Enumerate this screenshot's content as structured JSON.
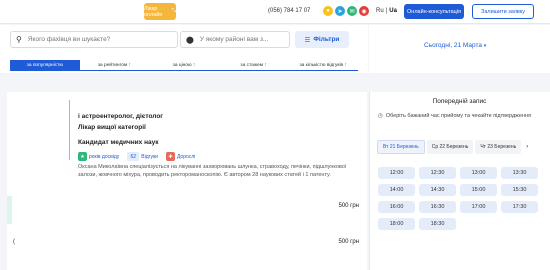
{
  "header": {
    "doctor_online_label": "Лікар онлайн",
    "phone": "(056) 784 17 07",
    "lang_ru": "Ru",
    "lang_ua": "Ua",
    "consult_button": "Онлайн-консультація",
    "request_button": "Залишити заявку"
  },
  "search": {
    "spec_placeholder": "Якого фахівця ви шукаєте?",
    "district_placeholder": "У якому районі вам з...",
    "filters_button": "Фільтри"
  },
  "sort_tabs": [
    {
      "label": "за популярністю",
      "active": true
    },
    {
      "label": "за рейтингом ↑",
      "active": false
    },
    {
      "label": "за ціною ↑",
      "active": false
    },
    {
      "label": "за стажем ↑",
      "active": false
    },
    {
      "label": "за кількістю відгуків ↑",
      "active": false
    }
  ],
  "date_select": "Сьогодні, 21 Марта",
  "doctor": {
    "title": "і астроентеролог, дієтолог",
    "category": "Лікар вищої категорії",
    "degree": "Кандидат медичних наук",
    "experience": "років досвіду",
    "reviews_count": "62",
    "reviews_label": "Відгуки",
    "children_label": "Дорослі",
    "description": "Оксана Миколаївна спеціалізується на лікуванні захворювань шлунка, стравоходу, печінки, підшлункової залози, жовчного міхура, проводить ректороманоскопію. Є автором 28 наукових статей і 1 патенту."
  },
  "prices": [
    {
      "mark": "",
      "value": "500 грн"
    },
    {
      "mark": "(",
      "value": "500 грн"
    }
  ],
  "appointment": {
    "title": "Попередній запис",
    "hint": "Оберіть бажаний час прийому та чекайте підтвердження",
    "days": [
      {
        "label": "Вт 21 Березень",
        "active": true
      },
      {
        "label": "Ср 22 Березень",
        "active": false
      },
      {
        "label": "Чт 23 Березень",
        "active": false
      }
    ],
    "slots": [
      "12:00",
      "12:30",
      "13:00",
      "13:30",
      "14:00",
      "14:30",
      "15:00",
      "15:30",
      "16:00",
      "16:30",
      "17:00",
      "17:30",
      "18:00",
      "18:30"
    ]
  },
  "colors": {
    "accent": "#1f5bd6",
    "online": "#f4b73b",
    "slot_bg": "#e5ecf9"
  }
}
